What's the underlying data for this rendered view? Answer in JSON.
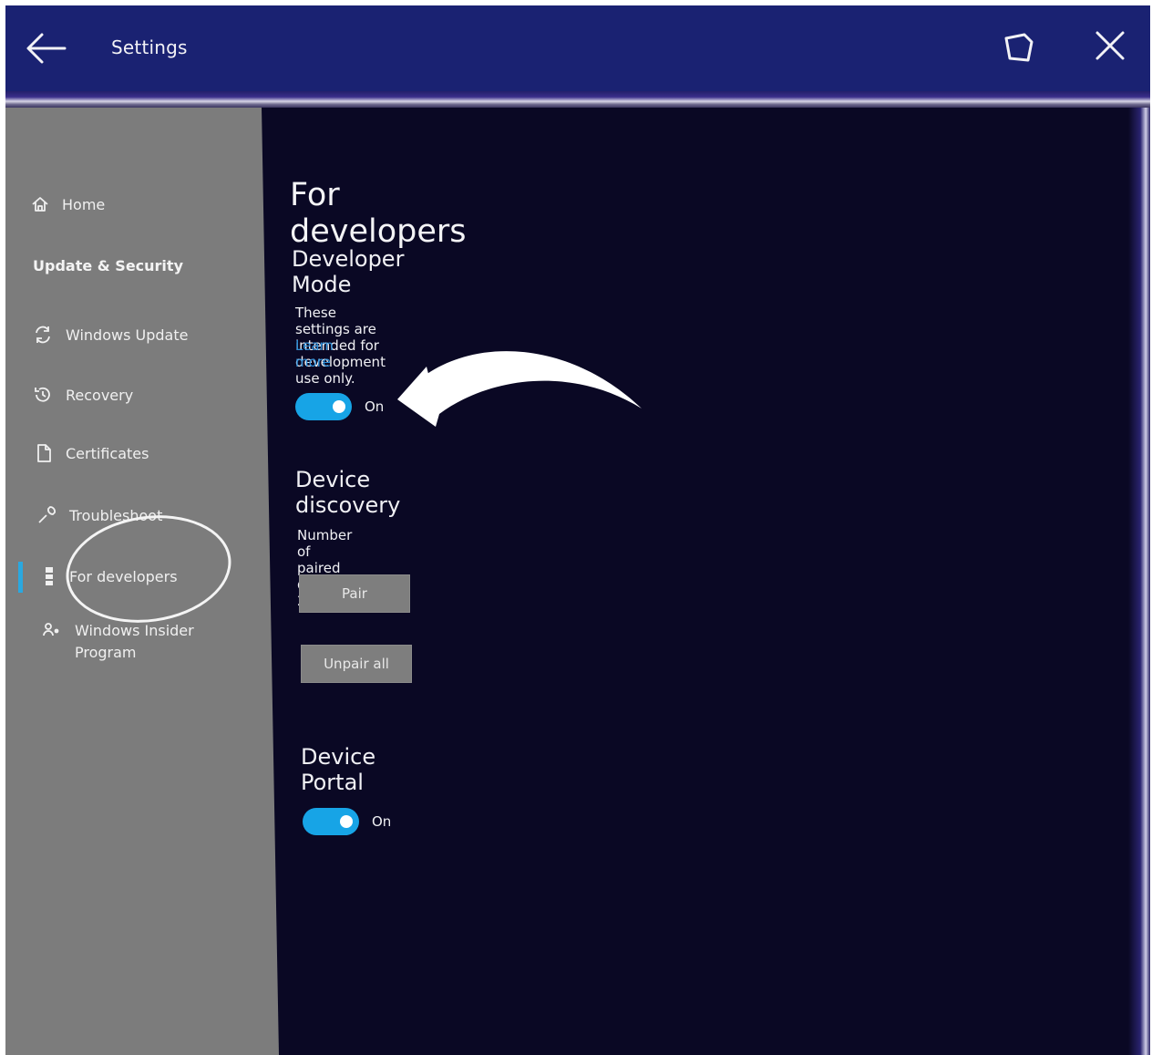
{
  "window": {
    "title": "Settings",
    "back_icon": "back-arrow-icon",
    "restore_icon": "restore-window-icon",
    "close_icon": "close-icon",
    "titlebar_color": "#1a2272"
  },
  "sidebar": {
    "home_label": "Home",
    "section_label": "Update & Security",
    "items": [
      {
        "label": "Windows Update",
        "icon": "sync-icon"
      },
      {
        "label": "Recovery",
        "icon": "history-icon"
      },
      {
        "label": "Certificates",
        "icon": "certificate-icon"
      },
      {
        "label": "Troubleshoot",
        "icon": "wrench-icon"
      },
      {
        "label": "For developers",
        "icon": "developer-tools-icon",
        "selected": true
      },
      {
        "label": "Windows Insider Program",
        "icon": "insider-icon"
      }
    ],
    "accent_color": "#2aa8e0"
  },
  "main": {
    "page_title": "For developers",
    "developer_mode": {
      "title": "Developer Mode",
      "description": "These settings are intended for development use only.",
      "learn_more": "Learn more",
      "toggle_label": "On",
      "toggle_on": true
    },
    "device_discovery": {
      "title": "Device discovery",
      "paired_text": "Number of paired devices: 2",
      "pair_button": "Pair",
      "unpair_button": "Unpair all"
    },
    "device_portal": {
      "title": "Device Portal",
      "toggle_label": "On",
      "toggle_on": true
    },
    "toggle_color": "#17a4e6",
    "link_color": "#2e8fd8"
  }
}
